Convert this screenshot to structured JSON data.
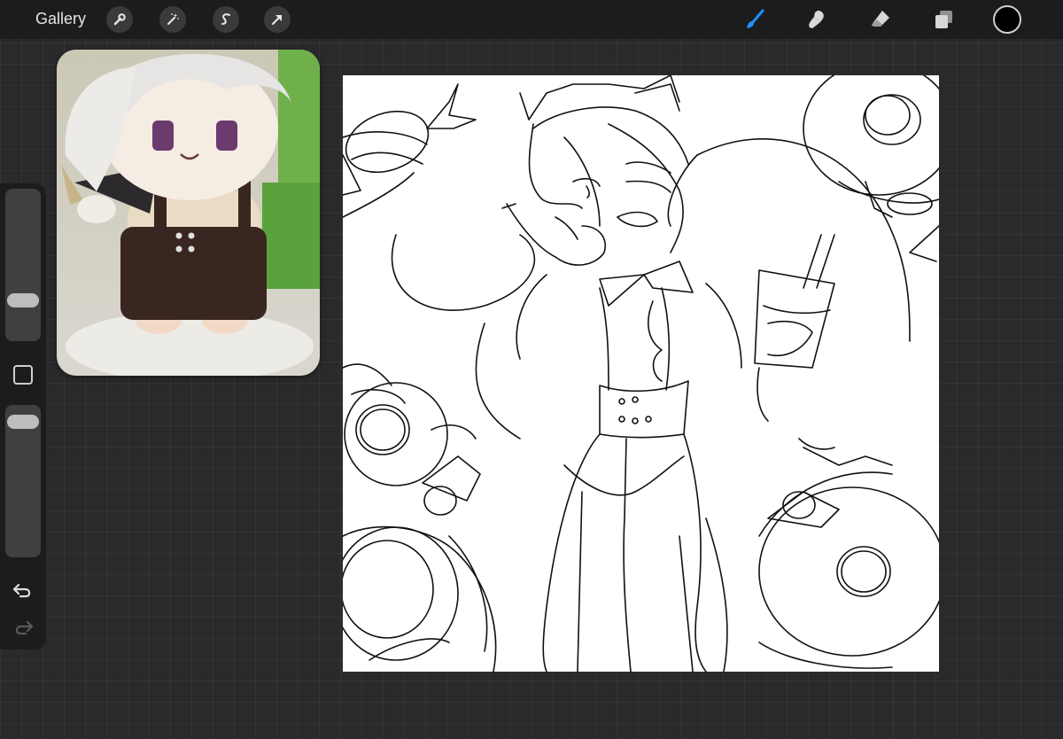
{
  "topbar": {
    "gallery_label": "Gallery",
    "left_tools": [
      "wrench-icon",
      "magic-wand-icon",
      "selection-icon",
      "transform-arrow-icon"
    ],
    "right_tools": [
      "brush-icon",
      "smudge-icon",
      "eraser-icon",
      "layers-icon"
    ],
    "active_tool": "brush",
    "current_color": "#000000",
    "accent_color": "#1f8fff"
  },
  "sidebar": {
    "brush_size_level": 0.23,
    "opacity_level": 0.95,
    "buttons": [
      "modify-square",
      "undo-icon",
      "redo-icon"
    ]
  },
  "reference_window": {
    "description_icon": "reference-image"
  }
}
